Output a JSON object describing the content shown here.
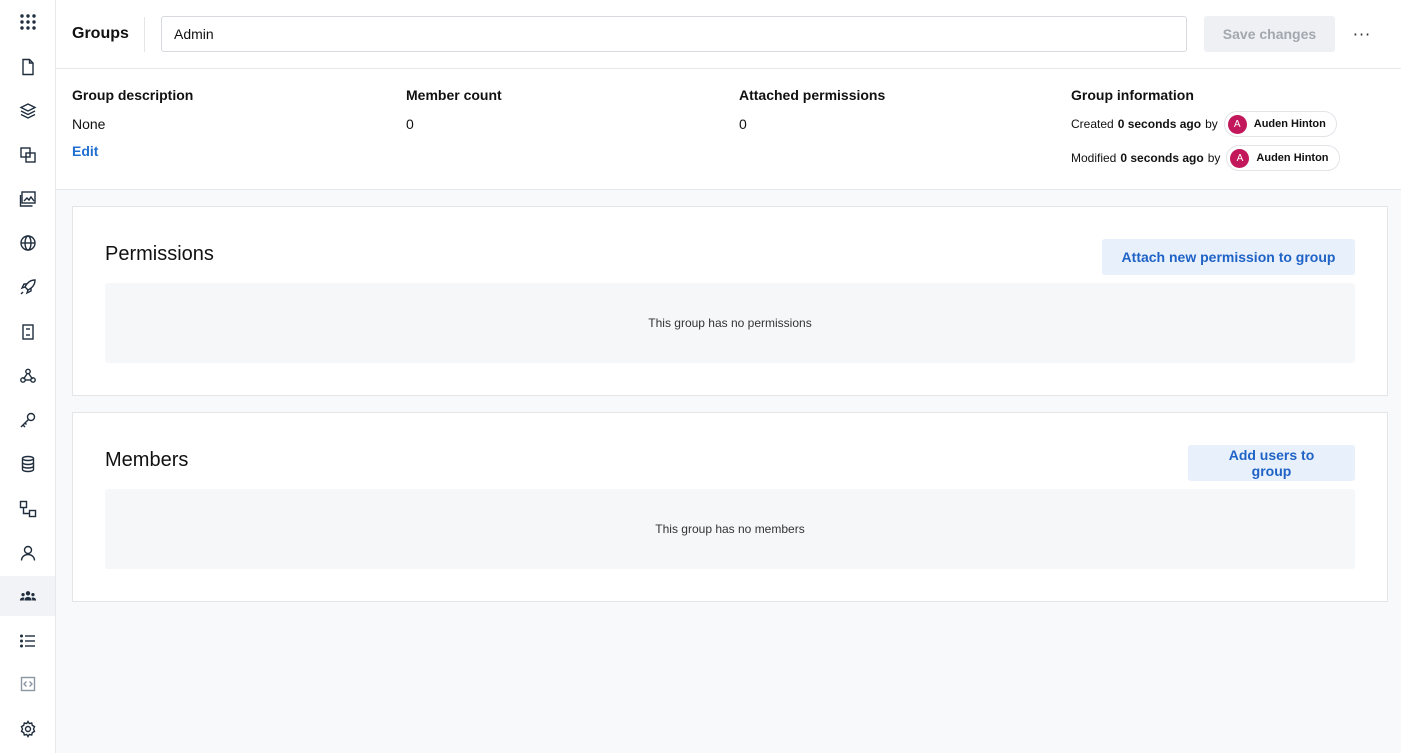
{
  "nav": {
    "items": [
      {
        "icon": "apps-grid-icon"
      },
      {
        "icon": "document-icon"
      },
      {
        "icon": "layers-icon"
      },
      {
        "icon": "overlap-squares-icon"
      },
      {
        "icon": "images-icon"
      },
      {
        "icon": "globe-icon"
      },
      {
        "icon": "rocket-icon"
      },
      {
        "icon": "notebook-icon"
      },
      {
        "icon": "webhook-icon"
      },
      {
        "icon": "key-icon"
      },
      {
        "icon": "database-icon"
      },
      {
        "icon": "workflow-icon"
      },
      {
        "icon": "user-icon"
      },
      {
        "icon": "groups-icon",
        "active": true
      },
      {
        "icon": "list-icon"
      },
      {
        "icon": "code-box-icon"
      },
      {
        "icon": "settings-icon"
      }
    ]
  },
  "header": {
    "breadcrumb": "Groups",
    "group_name_value": "Admin",
    "save_label": "Save changes",
    "more_label": "···"
  },
  "info": {
    "description": {
      "label": "Group description",
      "value": "None",
      "edit_label": "Edit"
    },
    "member_count": {
      "label": "Member count",
      "value": "0"
    },
    "permissions": {
      "label": "Attached permissions",
      "value": "0"
    },
    "group_info": {
      "label": "Group information",
      "created_prefix": "Created",
      "created_time": "0 seconds ago",
      "created_by": "by",
      "created_user": "Auden Hinton",
      "modified_prefix": "Modified",
      "modified_time": "0 seconds ago",
      "modified_by": "by",
      "modified_user": "Auden Hinton",
      "avatar_initial": "A",
      "avatar_color": "#c2185b"
    }
  },
  "permissions": {
    "title": "Permissions",
    "button": "Attach new permission to group",
    "empty": "This group has no permissions"
  },
  "members": {
    "title": "Members",
    "button": "Add users to group",
    "empty": "This group has no members"
  },
  "colors": {
    "accent": "#1f63c6",
    "accent_bg": "#e8f0fb",
    "page_bg": "#f8f9fb"
  }
}
